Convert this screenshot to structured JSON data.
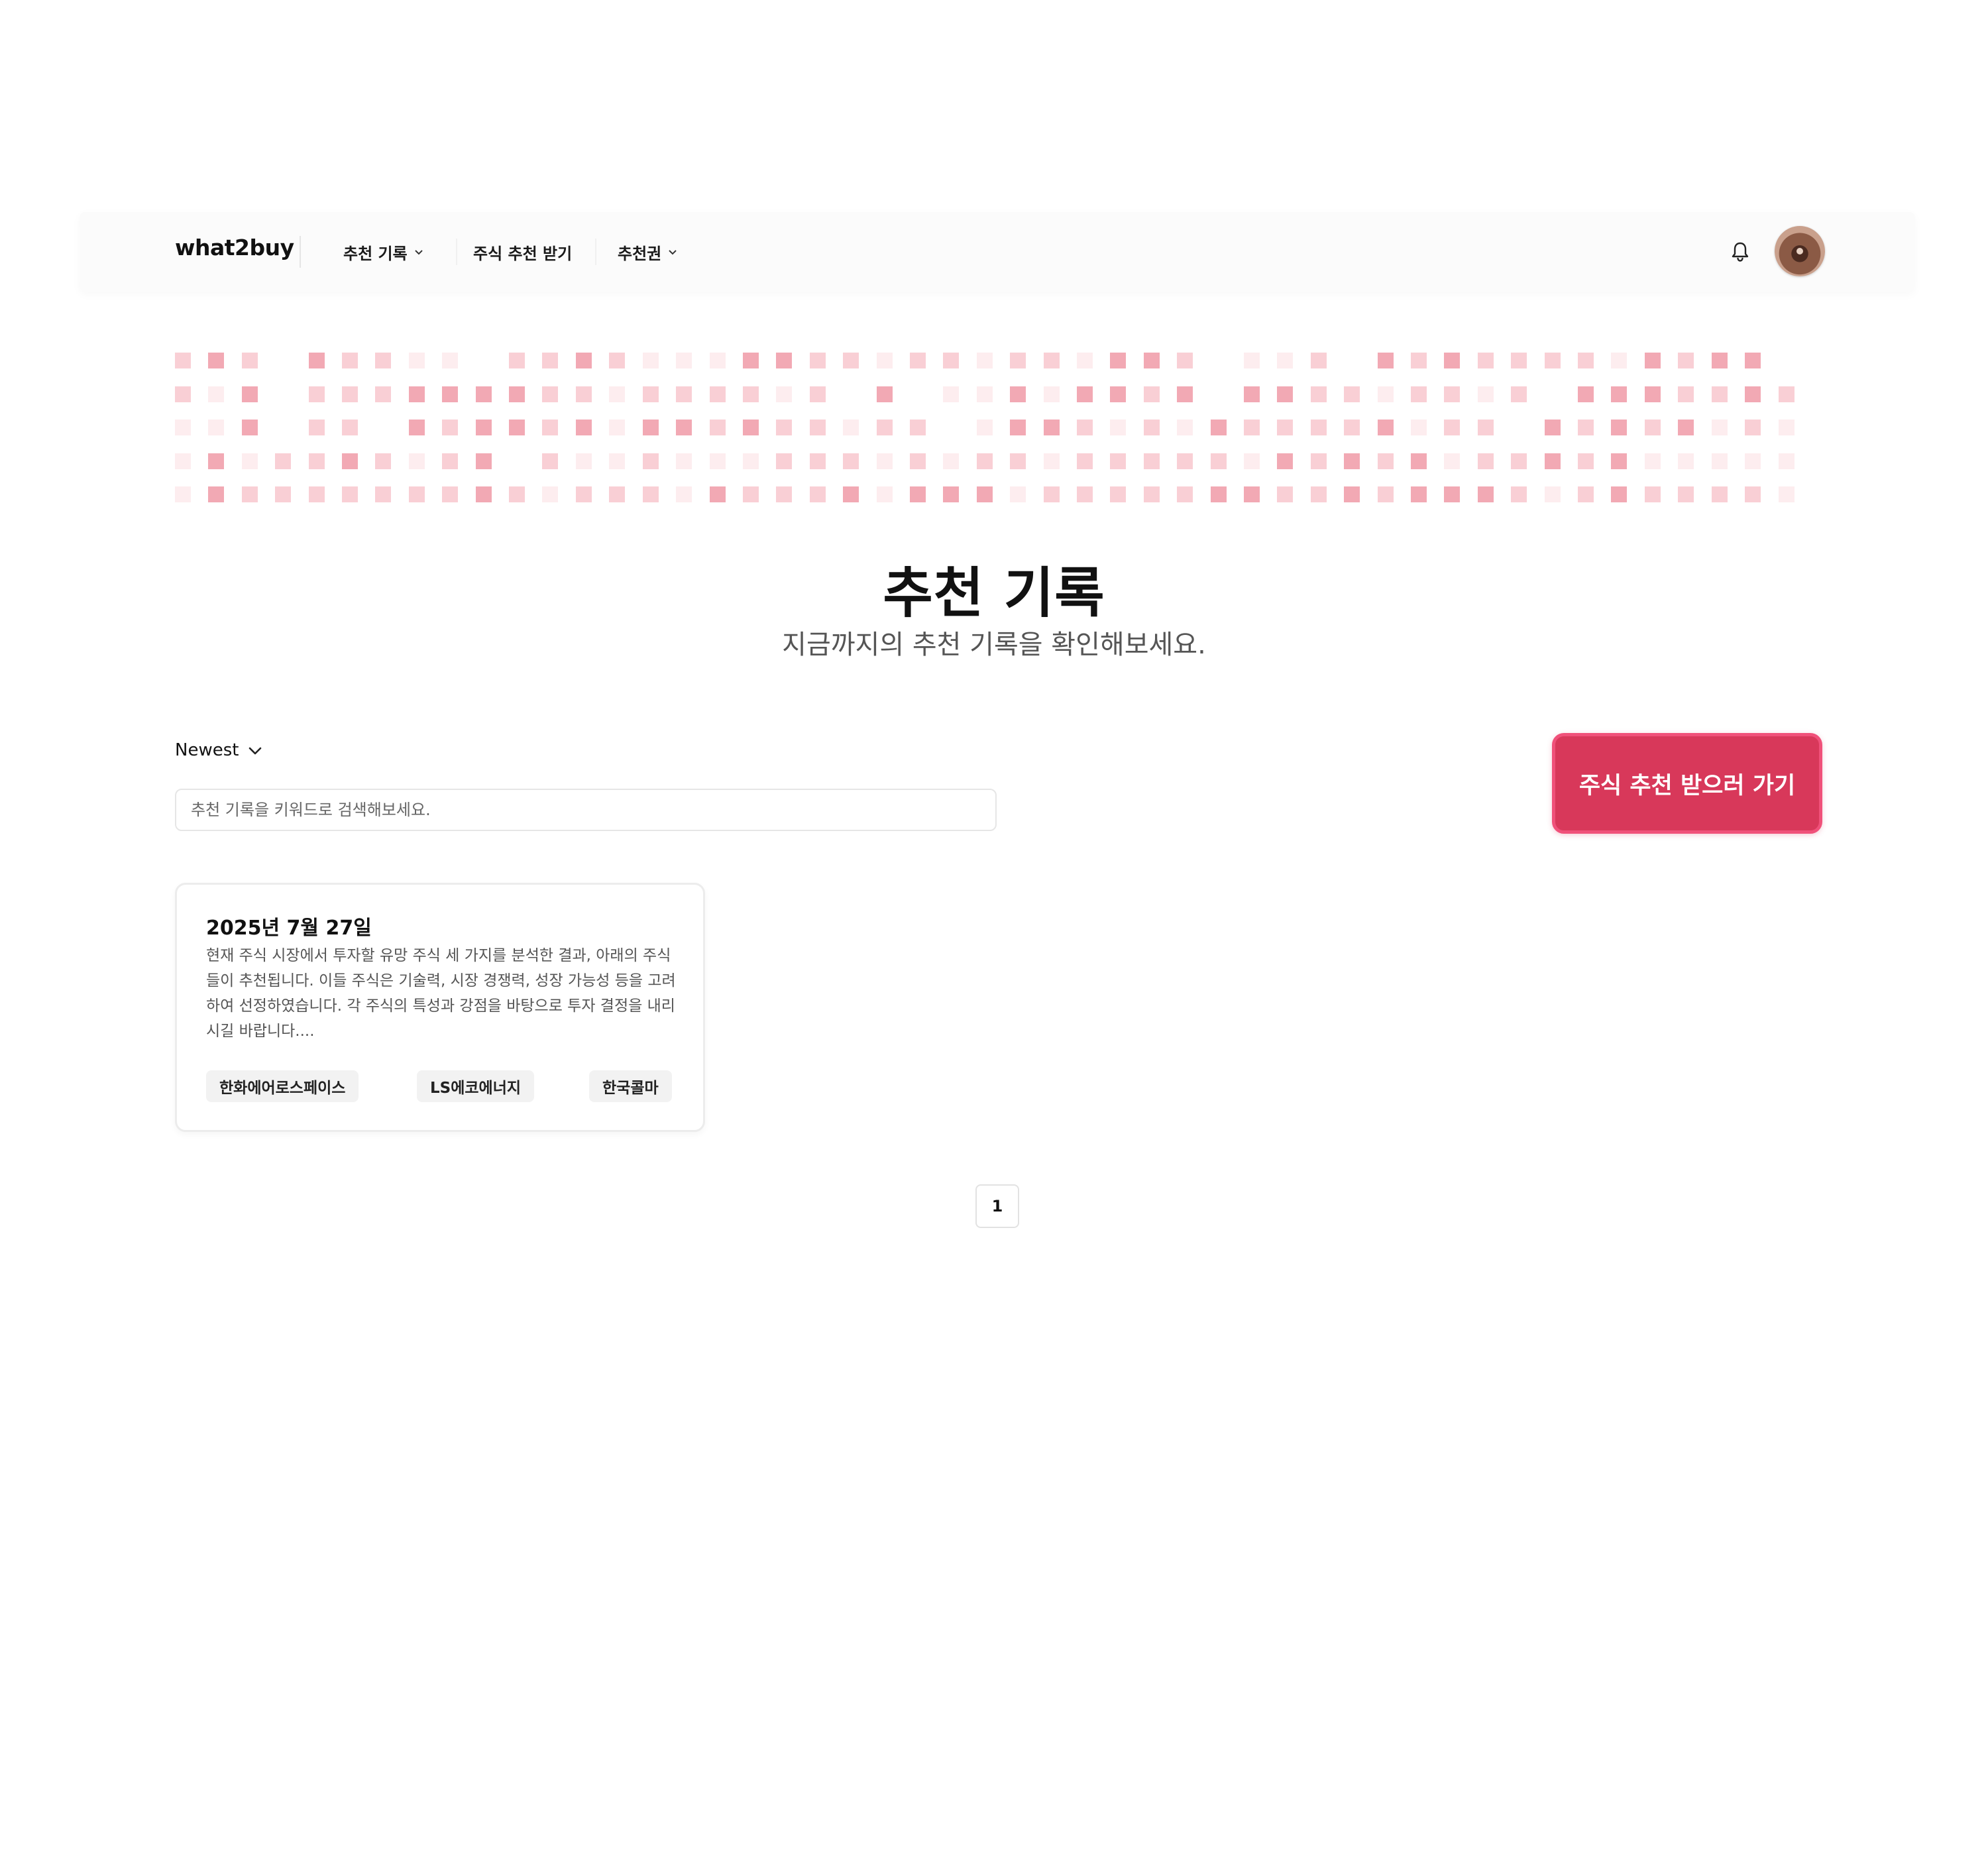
{
  "header": {
    "logo": "what2buy",
    "nav": [
      {
        "label": "추천 기록",
        "has_dropdown": true
      },
      {
        "label": "주식 추천 받기",
        "has_dropdown": false
      },
      {
        "label": "추천권",
        "has_dropdown": true
      }
    ],
    "icons": {
      "notifications": "bell-icon",
      "profile": "avatar",
      "dropdown": "chevron-down-icon"
    }
  },
  "activity_grid": {
    "colors": [
      "#ffffff",
      "#fdedef",
      "#f9cfd5",
      "#f2a9b4",
      "#ea8596"
    ],
    "rows": [
      "2320322110223211133221221221332011203232222132330",
      "2130222333322122221203011313323033221221203332232",
      "1130220323323133232212201332121322223122032323121",
      "1312232123021121112221212212222213232312232311111",
      "1322222223212221322231333122222332232333212322221"
    ]
  },
  "hero": {
    "title": "추천 기록",
    "subtitle": "지금까지의 추천 기록을 확인해보세요."
  },
  "controls": {
    "sort_label": "Newest",
    "search_placeholder": "추천 기록을 키워드로 검색해보세요.",
    "search_value": "",
    "cta_label": "주식 추천 받으러 가기"
  },
  "records": [
    {
      "date": "2025년 7월 27일",
      "summary": "현재 주식 시장에서 투자할 유망 주식 세 가지를 분석한 결과, 아래의 주식들이 추천됩니다. 이들 주식은 기술력, 시장 경쟁력, 성장 가능성 등을 고려하여 선정하였습니다. 각 주식의 특성과 강점을 바탕으로 투자 결정을 내리시길 바랍니다....",
      "stocks": [
        "한화에어로스페이스",
        "LS에코에너지",
        "한국콜마"
      ]
    }
  ],
  "pagination": {
    "pages": [
      "1"
    ],
    "current": "1"
  },
  "colors": {
    "accent": "#d8385a",
    "accent_border": "#f0517a"
  }
}
